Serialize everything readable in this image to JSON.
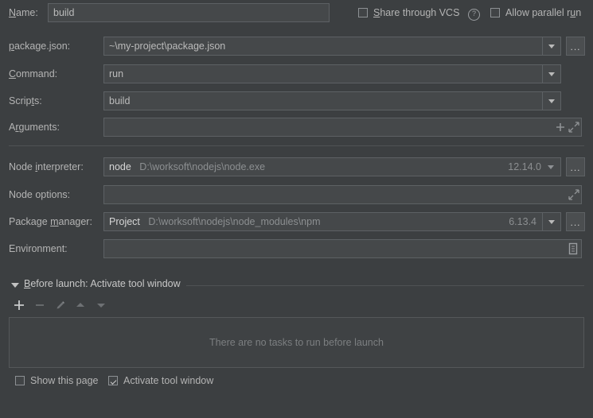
{
  "theme": {
    "background": "#3c3f41",
    "field_background": "#45484a",
    "field_border": "#5d6164",
    "text": "#b4b4b4",
    "dim_text": "#8c8f91",
    "separator": "#4f5254"
  },
  "name_row": {
    "label": "Name:",
    "mnemonic": "N",
    "value": "build",
    "share_vcs": {
      "label": "Share through VCS",
      "mnemonic": "S",
      "checked": false
    },
    "help_icon": "?",
    "allow_parallel": {
      "label": "Allow parallel run",
      "mnemonic": "u",
      "checked": false
    }
  },
  "fields": {
    "package_json": {
      "label": "package.json:",
      "mnemonic": "p",
      "value": "~\\my-project\\package.json",
      "has_dropdown": true,
      "browse_label": "..."
    },
    "command": {
      "label": "Command:",
      "mnemonic": "C",
      "value": "run",
      "has_dropdown": true
    },
    "scripts": {
      "label": "Scripts:",
      "mnemonic": "t",
      "value": "build",
      "has_dropdown": true
    },
    "arguments": {
      "label": "Arguments:",
      "mnemonic": "r",
      "value": "",
      "icons": [
        "plus-icon",
        "expand-icon"
      ]
    },
    "node_interpreter": {
      "label": "Node interpreter:",
      "mnemonic": "i",
      "name": "node",
      "path": "D:\\worksoft\\nodejs\\node.exe",
      "version": "12.14.0",
      "browse_label": "..."
    },
    "node_options": {
      "label": "Node options:",
      "value": "",
      "icons": [
        "expand-icon"
      ]
    },
    "package_manager": {
      "label": "Package manager:",
      "mnemonic": "m",
      "name": "Project",
      "path": "D:\\worksoft\\nodejs\\node_modules\\npm",
      "version": "6.13.4",
      "browse_label": "..."
    },
    "environment": {
      "label": "Environment:",
      "value": "",
      "icons": [
        "environment-list-icon"
      ]
    }
  },
  "before_launch": {
    "title": "Before launch: Activate tool window",
    "mnemonic": "B",
    "expanded": true,
    "toolbar": [
      {
        "name": "add-task-button",
        "glyph": "+",
        "enabled": true
      },
      {
        "name": "remove-task-button",
        "glyph": "−",
        "enabled": false
      },
      {
        "name": "edit-task-button",
        "glyph": "pencil-icon",
        "enabled": false
      },
      {
        "name": "move-up-button",
        "glyph": "arrow-up-icon",
        "enabled": false
      },
      {
        "name": "move-down-button",
        "glyph": "arrow-down-icon",
        "enabled": false
      }
    ],
    "empty_text": "There are no tasks to run before launch"
  },
  "footer": {
    "show_this_page": {
      "label": "Show this page",
      "checked": false
    },
    "activate_tool_window": {
      "label": "Activate tool window",
      "checked": true
    }
  }
}
